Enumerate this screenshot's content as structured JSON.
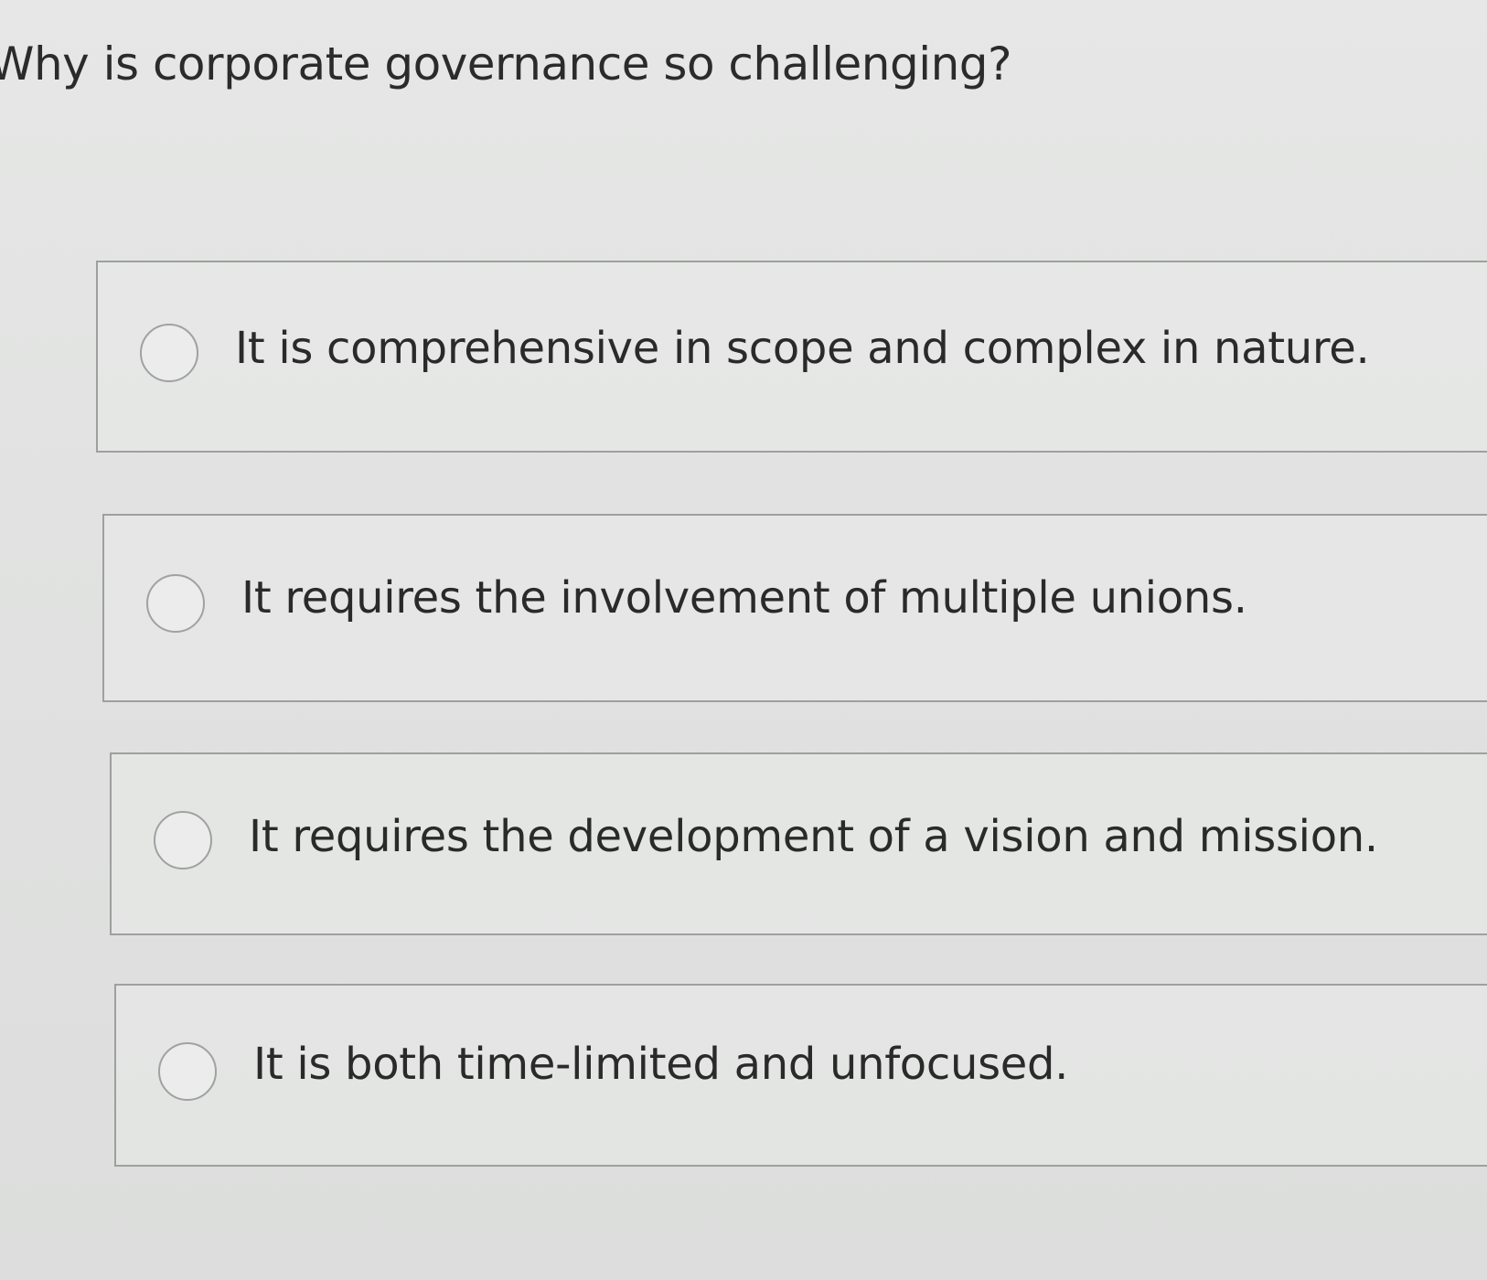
{
  "question": "Why is corporate governance so challenging?",
  "options": [
    {
      "label": "It is comprehensive in scope and complex in nature.",
      "selected": false
    },
    {
      "label": "It requires the involvement of multiple unions.",
      "selected": false
    },
    {
      "label": "It requires the development of a vision and mission.",
      "selected": false
    },
    {
      "label": "It is both time-limited and unfocused.",
      "selected": false
    }
  ]
}
